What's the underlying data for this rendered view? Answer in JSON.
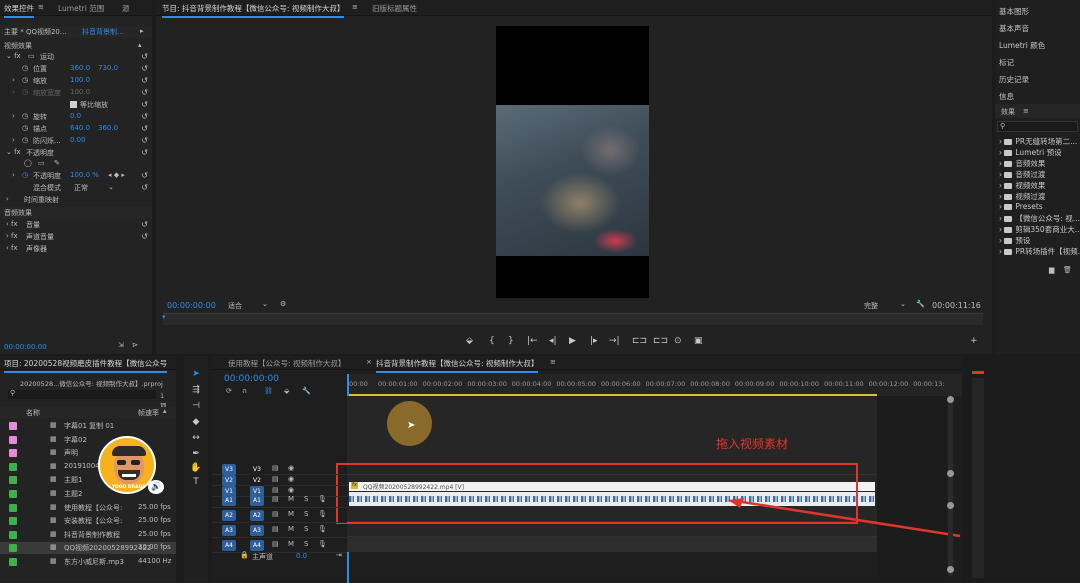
{
  "effect_controls": {
    "tabs": [
      "效果控件",
      "Lumetri 范围",
      "源"
    ],
    "header_left": "主要 * QQ视频20...",
    "header_right": "抖音背景制...",
    "video_effects": "视频效果",
    "motion": "运动",
    "position": "位置",
    "position_x": "360.0",
    "position_y": "730.0",
    "scale": "缩放",
    "scale_value": "100.0",
    "scale_width": "缩放宽度",
    "scale_width_value": "100.0",
    "uniform_scale": "等比缩放",
    "rotation": "旋转",
    "rotation_value": "0.0",
    "anchor": "锚点",
    "anchor_x": "640.0",
    "anchor_y": "360.0",
    "antiflicker": "防闪烁...",
    "antiflicker_value": "0.00",
    "opacity_group": "不透明度",
    "opacity": "不透明度",
    "opacity_value": "100.0 %",
    "blend_mode": "混合模式",
    "blend_value": "正常",
    "time_remap": "时间重映射",
    "audio_effects": "音频效果",
    "volume": "音量",
    "channel_volume": "声道音量",
    "panner": "声像器",
    "timecode": "00:00:00:00"
  },
  "program": {
    "tabs": [
      "节目: 抖音背景制作教程【微信公众号: 视频制作大叔】",
      "旧版标题属性"
    ],
    "timecode_left": "00:00:00:00",
    "fit": "适合",
    "quality": "完整",
    "timecode_right": "00:00:11:16"
  },
  "right_panel": {
    "items": [
      "基本图形",
      "基本声音",
      "Lumetri 颜色",
      "标记",
      "历史记录",
      "信息"
    ],
    "effects_title": "效果",
    "effects": [
      "PR无缝转场第二...",
      "Lumetri 预设",
      "音频效果",
      "音频过渡",
      "视频效果",
      "视频过渡",
      "Presets",
      "【微信公众号: 视...",
      "剪辑350套商业大...",
      "预设",
      "PR转场插件【视频..."
    ]
  },
  "project": {
    "title": "项目: 20200528视频磨皮插件教程【微信公众号",
    "path": "20200528...微信公众号: 视频制作大叔】.prproj",
    "count": "1 项...",
    "col_name": "名称",
    "col_fps": "帧速率",
    "items": [
      {
        "name": "字幕01 复制 01",
        "fps": "",
        "color": "#e58ad8"
      },
      {
        "name": "字幕02",
        "fps": "",
        "color": "#e58ad8"
      },
      {
        "name": "声明",
        "fps": "",
        "color": "#e58ad8"
      },
      {
        "name": "20191004_16...",
        "fps": "",
        "color": "#3fae4d"
      },
      {
        "name": "主题1",
        "fps": "",
        "color": "#3fae4d"
      },
      {
        "name": "主题2",
        "fps": "",
        "color": "#3fae4d"
      },
      {
        "name": "使用教程【公众号:",
        "fps": "25.00 fps",
        "color": "#3fae4d"
      },
      {
        "name": "安装教程【公众号:",
        "fps": "25.00 fps",
        "color": "#3fae4d"
      },
      {
        "name": "抖音背景制作教程",
        "fps": "25.00 fps",
        "color": "#3fae4d"
      },
      {
        "name": "QQ视频20200528992422",
        "fps": "30.00 fps",
        "color": "#3fae4d"
      },
      {
        "name": "东方小威尼斯.mp3",
        "fps": "44100 Hz",
        "color": "#3fae4d"
      }
    ]
  },
  "timeline": {
    "tabs": [
      "使用教程【公众号: 视频制作大叔】",
      "抖音背景制作教程【微信公众号: 视频制作大叔】"
    ],
    "timecode": "00:00:00:00",
    "ruler": [
      "00:00",
      "00:00:01:00",
      "00:00:02:00",
      "00:00:03:00",
      "00:00:04:00",
      "00:00:05:00",
      "00:00:06:00",
      "00:00:07:00",
      "00:00:08:00",
      "00:00:09:00",
      "00:00:10:00",
      "00:00:11:00",
      "00:00:12:00",
      "00:00:13:"
    ],
    "video_tracks": [
      "V3",
      "V2",
      "V1"
    ],
    "audio_tracks": [
      "A1",
      "A2",
      "A3",
      "A4"
    ],
    "master": "主声道",
    "master_value": "0.0",
    "clip_label": "QQ视频20200528992422.mp4 [V]",
    "annotation": "拖入视频素材",
    "badge": "YOGO DRAGO"
  }
}
